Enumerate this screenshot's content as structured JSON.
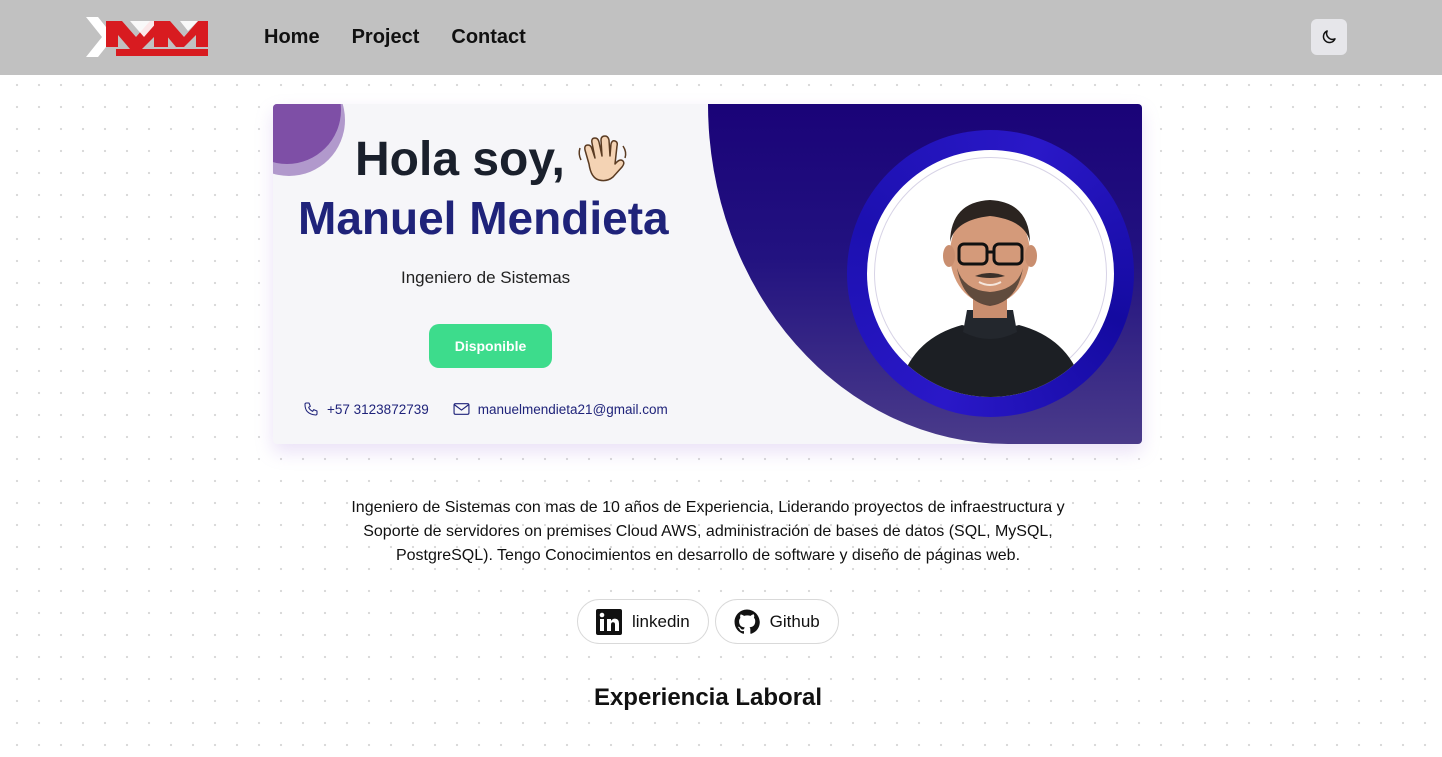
{
  "nav": {
    "logo_alt": "MM",
    "links": [
      {
        "label": "Home"
      },
      {
        "label": "Project"
      },
      {
        "label": "Contact"
      }
    ],
    "theme_toggle_icon": "moon-icon"
  },
  "hero": {
    "greeting": "Hola soy,",
    "greeting_icon": "waving-hand-icon",
    "name": "Manuel Mendieta",
    "role": "Ingeniero de Sistemas",
    "status": "Disponible",
    "phone": "+57 3123872739",
    "email": "manuelmendieta21@gmail.com",
    "colors": {
      "name": "#1f237a",
      "status": "#3ddc8c",
      "panel": "#1a0378",
      "ring": "#2a18c8"
    }
  },
  "bio": {
    "text": "Ingeniero de Sistemas con mas de 10 años de Experiencia, Liderando proyectos de infraestructura y Soporte de servidores on premises Cloud AWS, administración de bases de datos (SQL, MySQL, PostgreSQL). Tengo Conocimientos en desarrollo de software y diseño de páginas web."
  },
  "social": [
    {
      "label": "linkedin",
      "icon": "linkedin-icon"
    },
    {
      "label": "Github",
      "icon": "github-icon"
    }
  ],
  "section": {
    "title": "Experiencia Laboral"
  }
}
